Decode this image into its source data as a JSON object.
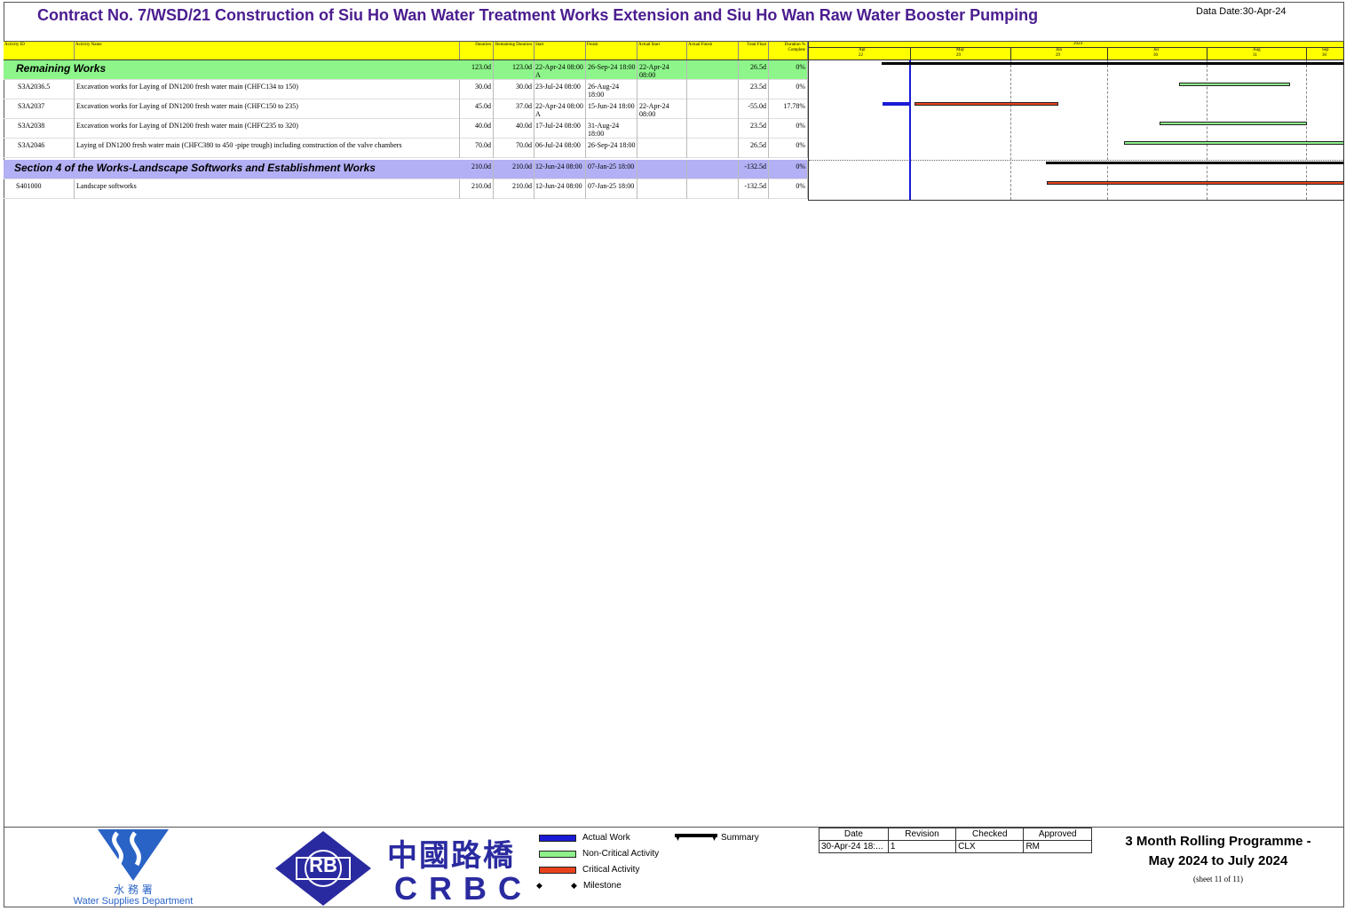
{
  "page": {
    "title": "Contract No. 7/WSD/21 Construction of Siu Ho Wan Water Treatment Works Extension and Siu Ho Wan Raw Water Booster Pumping",
    "data_date": "Data Date:30-Apr-24"
  },
  "columns": {
    "id": "Activity ID",
    "name": "Activity Name",
    "duration": "Duration",
    "remaining": "Remaining Duration",
    "start": "Start",
    "finish": "Finish",
    "actual_start": "Actual Start",
    "actual_finish": "Actual Finish",
    "float": "Total Float",
    "pct": "Duration % Complete"
  },
  "groups": [
    {
      "label": "Remaining Works",
      "duration": "123.0d",
      "remaining": "123.0d",
      "start": "22-Apr-24 08:00 A",
      "finish": "26-Sep-24 18:00",
      "actual_start": "22-Apr-24 08:00",
      "float": "26.5d",
      "pct": "0%"
    },
    {
      "label": "Section 4 of the Works-Landscape Softworks and Establishment Works",
      "duration": "210.0d",
      "remaining": "210.0d",
      "start": "12-Jun-24 08:00",
      "finish": "07-Jan-25 18:00",
      "actual_start": "",
      "float": "-132.5d",
      "pct": "0%"
    }
  ],
  "activities": [
    {
      "id": "S3A2036.5",
      "name": "Excavation works for Laying of DN1200 fresh water main (CHFC134 to 150)",
      "duration": "30.0d",
      "remaining": "30.0d",
      "start": "23-Jul-24 08:00",
      "finish": "26-Aug-24 18:00",
      "actual_start": "",
      "float": "23.5d",
      "pct": "0%"
    },
    {
      "id": "S3A2037",
      "name": "Excavation works for Laying of DN1200 fresh water main (CHFC150 to 235)",
      "duration": "45.0d",
      "remaining": "37.0d",
      "start": "22-Apr-24 08:00 A",
      "finish": "15-Jun-24 18:00",
      "actual_start": "22-Apr-24 08:00",
      "float": "-55.0d",
      "pct": "17.78%"
    },
    {
      "id": "S3A2038",
      "name": "Excavation works for Laying of DN1200 fresh water main (CHFC235 to 320)",
      "duration": "40.0d",
      "remaining": "40.0d",
      "start": "17-Jul-24 08:00",
      "finish": "31-Aug-24 18:00",
      "actual_start": "",
      "float": "23.5d",
      "pct": "0%"
    },
    {
      "id": "S3A2046",
      "name": "Laying of DN1200 fresh water main (CHFC380 to 450 -pipe trough) including construction of the valve chambers",
      "duration": "70.0d",
      "remaining": "70.0d",
      "start": "06-Jul-24 08:00",
      "finish": "26-Sep-24 18:00",
      "actual_start": "",
      "float": "26.5d",
      "pct": "0%"
    },
    {
      "id": "S401000",
      "name": "Landscape softworks",
      "duration": "210.0d",
      "remaining": "210.0d",
      "start": "12-Jun-24 08:00",
      "finish": "07-Jan-25 18:00",
      "actual_start": "",
      "float": "-132.5d",
      "pct": "0%"
    }
  ],
  "timescale": {
    "year": "2024",
    "months": [
      "Apr",
      "May",
      "Jun",
      "Jul",
      "Aug",
      "Sep"
    ],
    "weeks": [
      "22",
      "29",
      "29",
      "30",
      "31",
      "30"
    ]
  },
  "legend": {
    "actual_work": "Actual Work",
    "non_critical": "Non-Critical Activity",
    "critical": "Critical Activity",
    "milestone": "Milestone",
    "summary": "Summary"
  },
  "revision": {
    "headers": [
      "Date",
      "Revision",
      "Checked",
      "Approved"
    ],
    "values": [
      "30-Apr-24 18:...",
      "1",
      "CLX",
      "RM"
    ]
  },
  "programme": {
    "line1": "3 Month Rolling Programme -",
    "line2": "May 2024 to July 2024",
    "sheet": "(sheet 11 of 11)"
  },
  "logos": {
    "wsd_chinese": "水 務 署",
    "wsd_english": "Water Supplies Department",
    "rb": "RB",
    "crbc_chinese": "中國路橋",
    "crbc": "CRBC"
  },
  "colors": {
    "title": "#4b1d8f",
    "header": "#ffff00",
    "group_green": "#8df58a",
    "group_purple": "#b3b0f5",
    "critical": "#e8421c",
    "non_critical": "#8ef08a",
    "actual": "#1a1ad6",
    "brand_blue": "#2a2aa0"
  }
}
